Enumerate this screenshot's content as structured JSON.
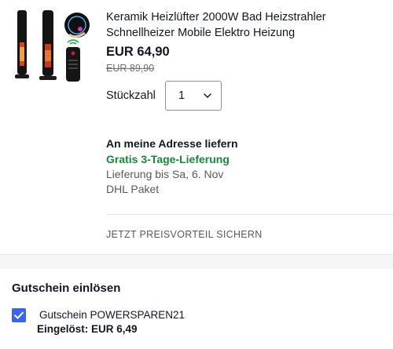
{
  "product": {
    "title": "Keramik Heizlüfter 2000W Bad Heizstrahler Schnellheizer Mobile Elektro Heizung",
    "price": "EUR 64,90",
    "old_price": "EUR 89,90",
    "image_icon": "product-heater-image"
  },
  "quantity": {
    "label": "Stückzahl",
    "selected": "1",
    "icon": "chevron-down-icon"
  },
  "delivery": {
    "title": "An meine Adresse liefern",
    "free_shipping": "Gratis 3-Tage-Lieferung",
    "date": "Lieferung bis Sa, 6. Nov",
    "carrier": "DHL Paket"
  },
  "promo": {
    "link": "JETZT PREISVORTEIL SICHERN"
  },
  "coupon": {
    "section_title": "Gutschein einlösen",
    "code_label": "Gutschein POWERSPAREN21",
    "applied_text": "Eingelöst: EUR 6,49",
    "checked": true
  },
  "colors": {
    "accent": "#3665f3",
    "success": "#168a3a",
    "text": "#111820",
    "muted": "#5a5a5a"
  }
}
